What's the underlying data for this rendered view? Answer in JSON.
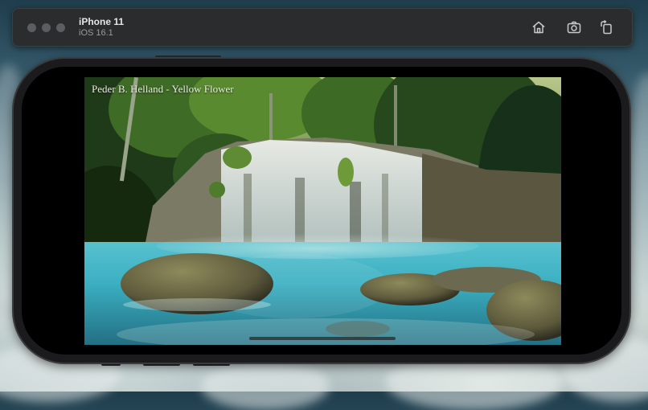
{
  "simulator": {
    "device_name": "iPhone 11",
    "os_version": "iOS 16.1",
    "toolbar_buttons": [
      {
        "icon": "home-icon"
      },
      {
        "icon": "camera-icon"
      },
      {
        "icon": "rotate-icon"
      }
    ]
  },
  "screen": {
    "video_title": "Peder B. Helland - Yellow Flower"
  }
}
